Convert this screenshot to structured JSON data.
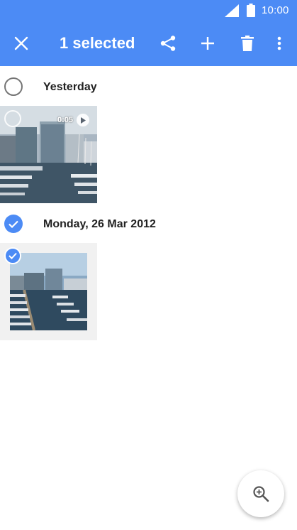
{
  "status_bar": {
    "time": "10:00",
    "signal_icon": "cellular-signal-icon",
    "battery_icon": "battery-icon"
  },
  "app_bar": {
    "title": "1 selected",
    "close_icon": "close-icon",
    "share_icon": "share-icon",
    "add_icon": "add-icon",
    "delete_icon": "delete-icon",
    "more_icon": "more-vert-icon",
    "background": "#4c8bf5"
  },
  "sections": [
    {
      "label": "Yesterday",
      "selected": false,
      "items": [
        {
          "type": "video",
          "duration": "0:05",
          "selected": false
        }
      ]
    },
    {
      "label": "Monday, 26 Mar 2012",
      "selected": true,
      "items": [
        {
          "type": "photo",
          "selected": true
        }
      ]
    }
  ],
  "fab": {
    "icon": "zoom-in-icon"
  },
  "colors": {
    "accent": "#4c8bf5",
    "text": "#212121"
  }
}
